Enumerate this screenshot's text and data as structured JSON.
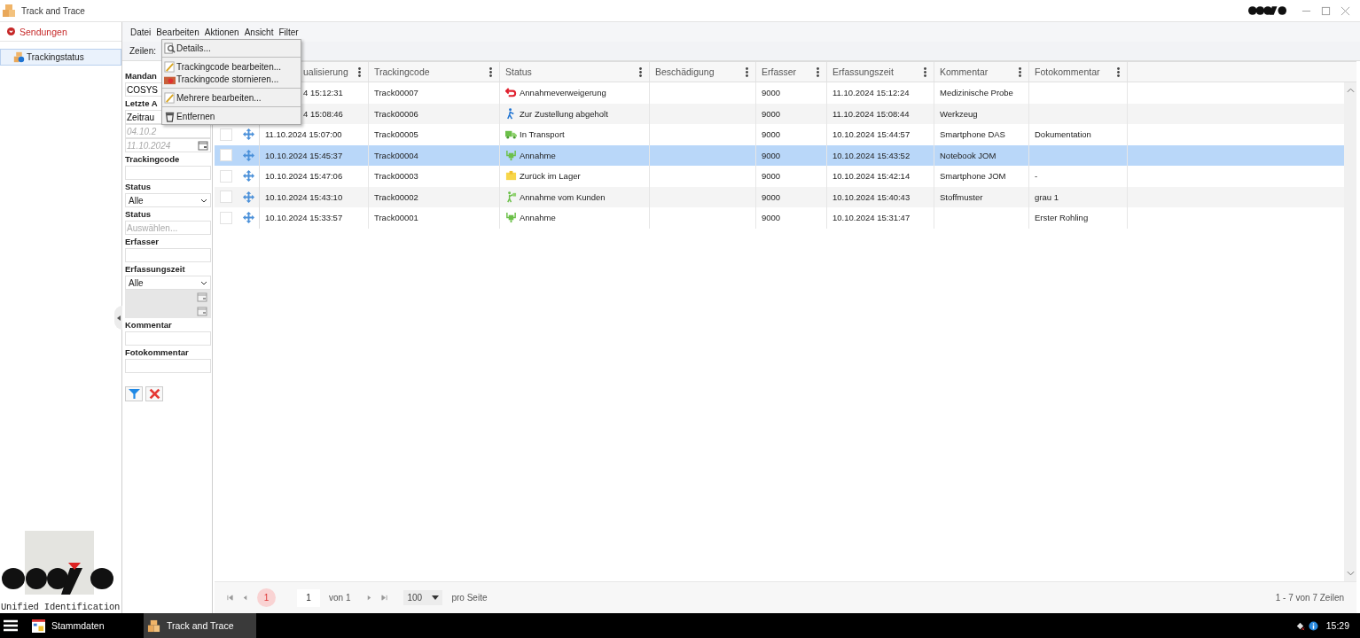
{
  "window": {
    "title": "Track and Trace"
  },
  "sidebar": {
    "header": "Sendungen",
    "items": [
      {
        "label": "Trackingstatus",
        "selected": true
      }
    ],
    "logo_caption": "Unified Identification"
  },
  "menubar": [
    "Datei",
    "Bearbeiten",
    "Aktionen",
    "Ansicht",
    "Filter"
  ],
  "open_menu": {
    "items": [
      {
        "kind": "details",
        "label": "Details..."
      },
      {
        "kind": "separator"
      },
      {
        "kind": "edit",
        "label": "Trackingcode bearbeiten..."
      },
      {
        "kind": "cancel",
        "label": "Trackingcode stornieren..."
      },
      {
        "kind": "separator"
      },
      {
        "kind": "edit",
        "label": "Mehrere bearbeiten..."
      },
      {
        "kind": "separator"
      },
      {
        "kind": "delete",
        "label": "Entfernen"
      }
    ]
  },
  "toolbar": {
    "label": "Zeilen:"
  },
  "filters": [
    {
      "kind": "label",
      "text": "Mandan"
    },
    {
      "kind": "field",
      "value": "COSYS"
    },
    {
      "kind": "label",
      "text": "Letzte A"
    },
    {
      "kind": "field",
      "value": "Zeitrau"
    },
    {
      "kind": "field",
      "placeholder": "04.10.2"
    },
    {
      "kind": "date",
      "placeholder": "11.10.2024"
    },
    {
      "kind": "label",
      "text": "Trackingcode"
    },
    {
      "kind": "text"
    },
    {
      "kind": "label",
      "text": "Status"
    },
    {
      "kind": "select",
      "value": "Alle"
    },
    {
      "kind": "label",
      "text": "Status"
    },
    {
      "kind": "text",
      "placeholder": "Auswählen..."
    },
    {
      "kind": "label",
      "text": "Erfasser"
    },
    {
      "kind": "text"
    },
    {
      "kind": "label",
      "text": "Erfassungszeit"
    },
    {
      "kind": "select",
      "value": "Alle"
    },
    {
      "kind": "disabled-date"
    },
    {
      "kind": "disabled-date"
    },
    {
      "kind": "label",
      "text": "Kommentar"
    },
    {
      "kind": "text"
    },
    {
      "kind": "label",
      "text": "Fotokommentar"
    },
    {
      "kind": "text"
    }
  ],
  "table": {
    "columns": [
      {
        "label": "ualisierung"
      },
      {
        "label": "Trackingcode"
      },
      {
        "label": "Status"
      },
      {
        "label": "Beschädigung"
      },
      {
        "label": "Erfasser"
      },
      {
        "label": "Erfassungszeit"
      },
      {
        "label": "Kommentar"
      },
      {
        "label": "Fotokommentar"
      }
    ],
    "rows": [
      {
        "selected": false,
        "column_3": "4 15:12:31",
        "trackingcode": "Track00007",
        "status": {
          "text": "Annahmeverweigerung",
          "kind": "refused"
        },
        "erfasser": "9000",
        "erfassungszeit": "11.10.2024 15:12:24",
        "kommentar": "Medizinische Probe"
      },
      {
        "selected": false,
        "column_3": "4 15:08:46",
        "trackingcode": "Track00006",
        "status": {
          "text": "Zur Zustellung abgeholt",
          "kind": "pickup"
        },
        "erfasser": "9000",
        "erfassungszeit": "11.10.2024 15:08:44",
        "kommentar": "Werkzeug"
      },
      {
        "selected": false,
        "column_3": "11.10.2024 15:07:00",
        "trackingcode": "Track00005",
        "status": {
          "text": "In Transport",
          "kind": "transport"
        },
        "erfasser": "9000",
        "erfassungszeit": "10.10.2024 15:44:57",
        "kommentar": "Smartphone DAS",
        "fotokommentar": "Dokumentation"
      },
      {
        "selected": true,
        "column_3": "10.10.2024 15:45:37",
        "trackingcode": "Track00004",
        "status": {
          "text": "Annahme",
          "kind": "accepted"
        },
        "erfasser": "9000",
        "erfassungszeit": "10.10.2024 15:43:52",
        "kommentar": "Notebook JOM"
      },
      {
        "selected": false,
        "column_3": "10.10.2024 15:47:06",
        "trackingcode": "Track00003",
        "status": {
          "text": "Zurück im Lager",
          "kind": "warehouse"
        },
        "erfasser": "9000",
        "erfassungszeit": "10.10.2024 15:42:14",
        "kommentar": "Smartphone JOM",
        "fotokommentar": "-"
      },
      {
        "selected": false,
        "column_3": "10.10.2024 15:43:10",
        "trackingcode": "Track00002",
        "status": {
          "text": "Annahme vom Kunden",
          "kind": "from-customer"
        },
        "erfasser": "9000",
        "erfassungszeit": "10.10.2024 15:40:43",
        "kommentar": "Stoffmuster",
        "fotokommentar": "grau 1"
      },
      {
        "selected": false,
        "column_3": "10.10.2024 15:33:57",
        "trackingcode": "Track00001",
        "status": {
          "text": "Annahme",
          "kind": "accepted"
        },
        "erfasser": "9000",
        "erfassungszeit": "10.10.2024 15:31:47",
        "fotokommentar": "Erster Rohling"
      }
    ]
  },
  "pagination": {
    "current_page": "1",
    "page_input": "1",
    "page_total": "von 1",
    "page_size": "100",
    "page_size_label": "pro Seite",
    "summary": "1 - 7 von 7 Zeilen"
  },
  "taskbar": {
    "items": [
      {
        "label": "Stammdaten",
        "kind": "master-data",
        "selected": false
      },
      {
        "label": "Track and Trace",
        "kind": "boxes",
        "selected": true
      }
    ],
    "clock": "15:29"
  }
}
